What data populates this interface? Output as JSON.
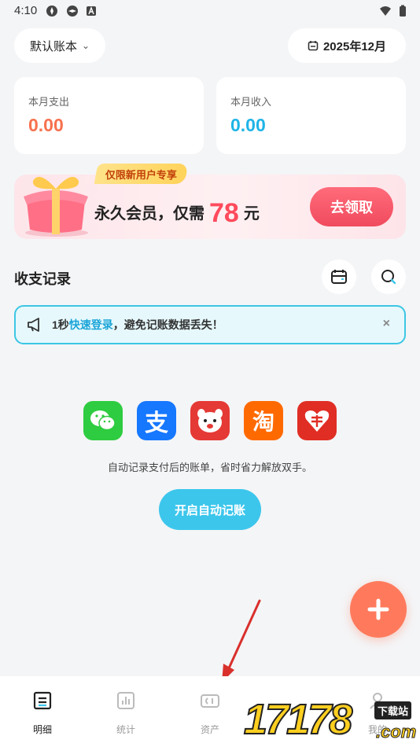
{
  "status_bar": {
    "time": "4:10"
  },
  "header": {
    "book_label": "默认账本",
    "date_label": "2025年12月"
  },
  "summary": {
    "expense_label": "本月支出",
    "expense_value": "0.00",
    "expense_color": "#f7714f",
    "income_label": "本月收入",
    "income_value": "0.00",
    "income_color": "#1fb4e6"
  },
  "promo": {
    "tag": "仅限新用户专享",
    "text_before": "永久会员，仅需",
    "price": "78",
    "text_after": "元",
    "button": "去领取"
  },
  "records": {
    "title": "收支记录"
  },
  "notice": {
    "prefix": "1秒",
    "link": "快速登录",
    "suffix": "，避免记账数据丢失！",
    "close": "×"
  },
  "auto_record": {
    "apps": [
      "wechat-icon",
      "alipay-icon",
      "jd-icon",
      "taobao-icon",
      "pinduoduo-icon"
    ],
    "alipay_glyph": "支",
    "taobao_glyph": "淘",
    "description": "自动记录支付后的账单，省时省力解放双手。",
    "button": "开启自动记账"
  },
  "fab": {
    "label": "+"
  },
  "nav": [
    {
      "label": "明细",
      "icon": "list-icon",
      "active": true
    },
    {
      "label": "统计",
      "icon": "chart-icon",
      "active": false
    },
    {
      "label": "资产",
      "icon": "wallet-icon",
      "active": false
    },
    {
      "label": "我的",
      "icon": "profile-icon",
      "active": false
    }
  ],
  "watermark": {
    "big": "17178",
    "small1": "下载站",
    "small2": ".com"
  },
  "colors": {
    "accent": "#3cc6ec",
    "fab": "#ff7a5c",
    "promo_button": "#f04b5e"
  }
}
